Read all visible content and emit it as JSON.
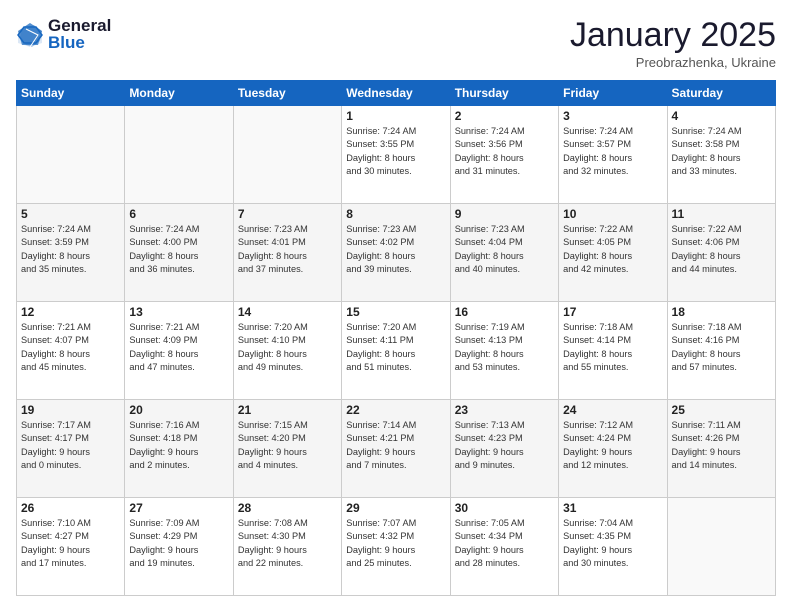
{
  "logo": {
    "line1": "General",
    "line2": "Blue"
  },
  "title": "January 2025",
  "location": "Preobrazhenka, Ukraine",
  "days_header": [
    "Sunday",
    "Monday",
    "Tuesday",
    "Wednesday",
    "Thursday",
    "Friday",
    "Saturday"
  ],
  "weeks": [
    [
      {
        "num": "",
        "info": ""
      },
      {
        "num": "",
        "info": ""
      },
      {
        "num": "",
        "info": ""
      },
      {
        "num": "1",
        "info": "Sunrise: 7:24 AM\nSunset: 3:55 PM\nDaylight: 8 hours\nand 30 minutes."
      },
      {
        "num": "2",
        "info": "Sunrise: 7:24 AM\nSunset: 3:56 PM\nDaylight: 8 hours\nand 31 minutes."
      },
      {
        "num": "3",
        "info": "Sunrise: 7:24 AM\nSunset: 3:57 PM\nDaylight: 8 hours\nand 32 minutes."
      },
      {
        "num": "4",
        "info": "Sunrise: 7:24 AM\nSunset: 3:58 PM\nDaylight: 8 hours\nand 33 minutes."
      }
    ],
    [
      {
        "num": "5",
        "info": "Sunrise: 7:24 AM\nSunset: 3:59 PM\nDaylight: 8 hours\nand 35 minutes."
      },
      {
        "num": "6",
        "info": "Sunrise: 7:24 AM\nSunset: 4:00 PM\nDaylight: 8 hours\nand 36 minutes."
      },
      {
        "num": "7",
        "info": "Sunrise: 7:23 AM\nSunset: 4:01 PM\nDaylight: 8 hours\nand 37 minutes."
      },
      {
        "num": "8",
        "info": "Sunrise: 7:23 AM\nSunset: 4:02 PM\nDaylight: 8 hours\nand 39 minutes."
      },
      {
        "num": "9",
        "info": "Sunrise: 7:23 AM\nSunset: 4:04 PM\nDaylight: 8 hours\nand 40 minutes."
      },
      {
        "num": "10",
        "info": "Sunrise: 7:22 AM\nSunset: 4:05 PM\nDaylight: 8 hours\nand 42 minutes."
      },
      {
        "num": "11",
        "info": "Sunrise: 7:22 AM\nSunset: 4:06 PM\nDaylight: 8 hours\nand 44 minutes."
      }
    ],
    [
      {
        "num": "12",
        "info": "Sunrise: 7:21 AM\nSunset: 4:07 PM\nDaylight: 8 hours\nand 45 minutes."
      },
      {
        "num": "13",
        "info": "Sunrise: 7:21 AM\nSunset: 4:09 PM\nDaylight: 8 hours\nand 47 minutes."
      },
      {
        "num": "14",
        "info": "Sunrise: 7:20 AM\nSunset: 4:10 PM\nDaylight: 8 hours\nand 49 minutes."
      },
      {
        "num": "15",
        "info": "Sunrise: 7:20 AM\nSunset: 4:11 PM\nDaylight: 8 hours\nand 51 minutes."
      },
      {
        "num": "16",
        "info": "Sunrise: 7:19 AM\nSunset: 4:13 PM\nDaylight: 8 hours\nand 53 minutes."
      },
      {
        "num": "17",
        "info": "Sunrise: 7:18 AM\nSunset: 4:14 PM\nDaylight: 8 hours\nand 55 minutes."
      },
      {
        "num": "18",
        "info": "Sunrise: 7:18 AM\nSunset: 4:16 PM\nDaylight: 8 hours\nand 57 minutes."
      }
    ],
    [
      {
        "num": "19",
        "info": "Sunrise: 7:17 AM\nSunset: 4:17 PM\nDaylight: 9 hours\nand 0 minutes."
      },
      {
        "num": "20",
        "info": "Sunrise: 7:16 AM\nSunset: 4:18 PM\nDaylight: 9 hours\nand 2 minutes."
      },
      {
        "num": "21",
        "info": "Sunrise: 7:15 AM\nSunset: 4:20 PM\nDaylight: 9 hours\nand 4 minutes."
      },
      {
        "num": "22",
        "info": "Sunrise: 7:14 AM\nSunset: 4:21 PM\nDaylight: 9 hours\nand 7 minutes."
      },
      {
        "num": "23",
        "info": "Sunrise: 7:13 AM\nSunset: 4:23 PM\nDaylight: 9 hours\nand 9 minutes."
      },
      {
        "num": "24",
        "info": "Sunrise: 7:12 AM\nSunset: 4:24 PM\nDaylight: 9 hours\nand 12 minutes."
      },
      {
        "num": "25",
        "info": "Sunrise: 7:11 AM\nSunset: 4:26 PM\nDaylight: 9 hours\nand 14 minutes."
      }
    ],
    [
      {
        "num": "26",
        "info": "Sunrise: 7:10 AM\nSunset: 4:27 PM\nDaylight: 9 hours\nand 17 minutes."
      },
      {
        "num": "27",
        "info": "Sunrise: 7:09 AM\nSunset: 4:29 PM\nDaylight: 9 hours\nand 19 minutes."
      },
      {
        "num": "28",
        "info": "Sunrise: 7:08 AM\nSunset: 4:30 PM\nDaylight: 9 hours\nand 22 minutes."
      },
      {
        "num": "29",
        "info": "Sunrise: 7:07 AM\nSunset: 4:32 PM\nDaylight: 9 hours\nand 25 minutes."
      },
      {
        "num": "30",
        "info": "Sunrise: 7:05 AM\nSunset: 4:34 PM\nDaylight: 9 hours\nand 28 minutes."
      },
      {
        "num": "31",
        "info": "Sunrise: 7:04 AM\nSunset: 4:35 PM\nDaylight: 9 hours\nand 30 minutes."
      },
      {
        "num": "",
        "info": ""
      }
    ]
  ]
}
